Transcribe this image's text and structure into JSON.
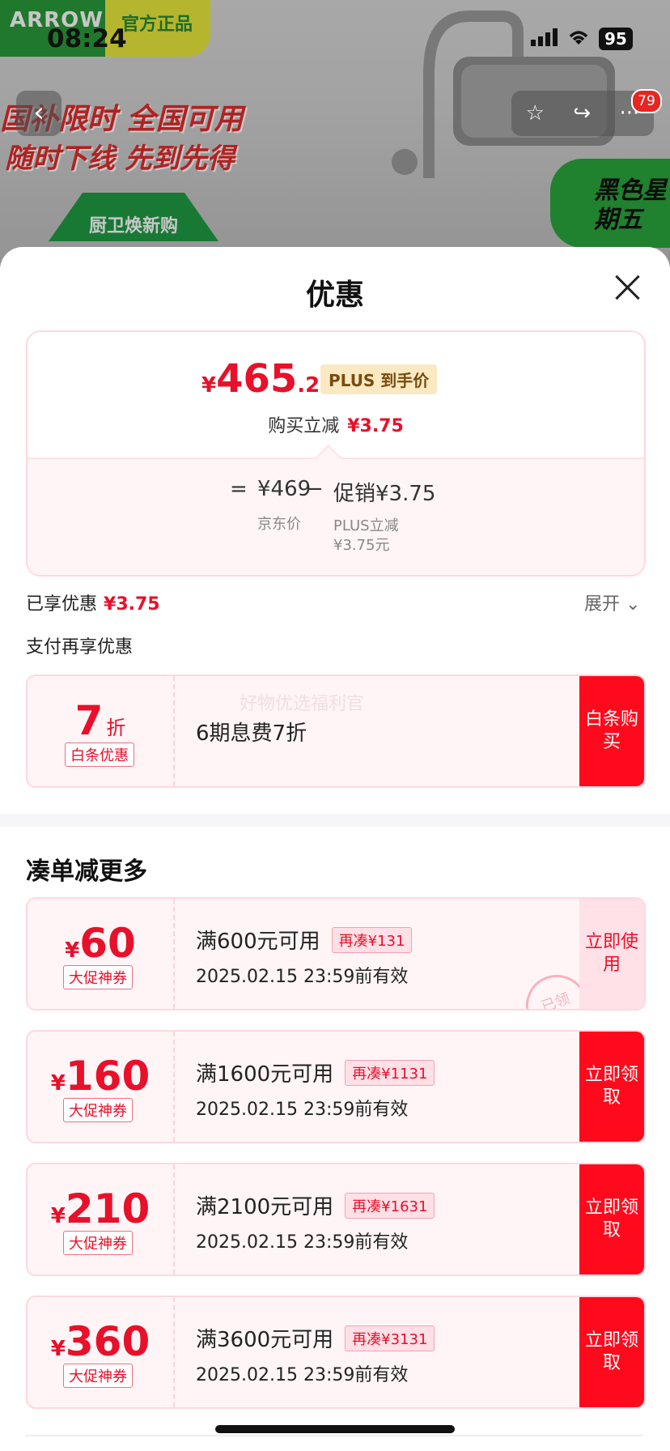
{
  "status_bar": {
    "time": "08:24",
    "battery": "95"
  },
  "banner": {
    "brand": "ARROW",
    "official": "官方正品",
    "promo_line1": "国补限时 全国可用",
    "promo_line2": "随时下线 先到先得",
    "promo_line3": "厨卫焕新购",
    "black_friday": "黑色星期五",
    "badge_count": "79"
  },
  "sheet": {
    "title": "优惠",
    "price": {
      "yen": "¥",
      "integer": "465",
      "decimal": ".25",
      "plus_tag": "PLUS 到手价"
    },
    "buy_reduce": {
      "label": "购买立减",
      "amount": "¥3.75"
    },
    "breakdown": {
      "equals": "=",
      "jd_price": "¥469",
      "jd_label": "京东价",
      "minus": "−",
      "promo": "促销¥3.75",
      "promo_label1": "PLUS立减",
      "promo_label2": "¥3.75元"
    },
    "enjoyed": {
      "label": "已享优惠",
      "amount": "¥3.75"
    },
    "expand": "展开",
    "pay_more": "支付再享优惠",
    "baitiao": {
      "value": "7",
      "unit": "折",
      "tag": "白条优惠",
      "desc": "6期息费7折",
      "watermark": "好物优选福利官",
      "button": "白条购买"
    },
    "more_title": "凑单减更多",
    "coupons": [
      {
        "value": "60",
        "tag": "大促神券",
        "condition": "满600元可用",
        "gap": "再凑¥131",
        "expiry": "2025.02.15 23:59前有效",
        "button": "立即使用",
        "stamp": "已领"
      },
      {
        "value": "160",
        "tag": "大促神券",
        "condition": "满1600元可用",
        "gap": "再凑¥1131",
        "expiry": "2025.02.15 23:59前有效",
        "button": "立即领取"
      },
      {
        "value": "210",
        "tag": "大促神券",
        "condition": "满2100元可用",
        "gap": "再凑¥1631",
        "expiry": "2025.02.15 23:59前有效",
        "button": "立即领取"
      },
      {
        "value": "360",
        "tag": "大促神券",
        "condition": "满3600元可用",
        "gap": "再凑¥3131",
        "expiry": "2025.02.15 23:59前有效",
        "button": "立即领取"
      }
    ]
  },
  "colors": {
    "accent": "#e8102a",
    "button": "#ff0a1c",
    "card_bg": "#fff5f7"
  }
}
